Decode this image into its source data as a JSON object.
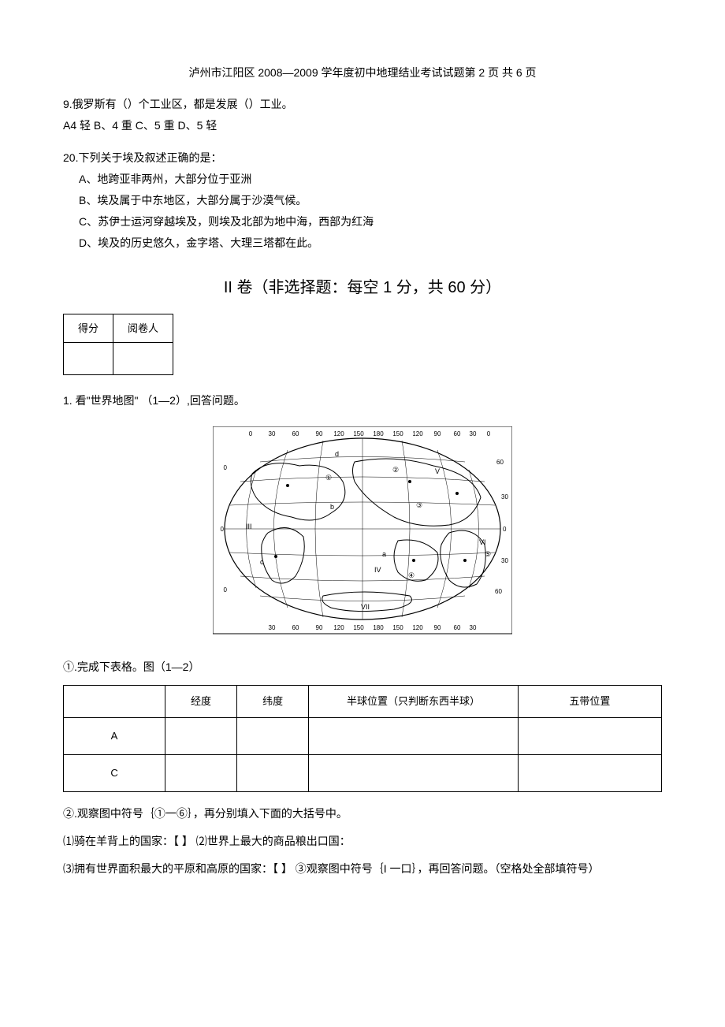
{
  "header": {
    "page_info": "泸州市江阳区 2008—2009 学年度初中地理结业考试试题第 2 页  共 6 页"
  },
  "q9": {
    "stem": "9.俄罗斯有（）个工业区，都是发展（）工业。",
    "options": "A4 轻 B、4 重 C、5 重 D、5 轻"
  },
  "q20": {
    "stem": "20.下列关于埃及叙述正确的是：",
    "opt_a": "A、地跨亚非两州，大部分位于亚洲",
    "opt_b": "B、埃及属于中东地区，大部分属于沙漠气候。",
    "opt_c": "C、苏伊士运河穿越埃及，则埃及北部为地中海，西部为红海",
    "opt_d": "D、埃及的历史悠久，金字塔、大理三塔都在此。"
  },
  "section2": {
    "title": "II 卷（非选择题：每空 1 分，共 60 分）"
  },
  "score_table": {
    "h1": "得分",
    "h2": "阅卷人"
  },
  "q2_1": {
    "stem": "1. 看\"世界地图\"  （1—2）,回答问题。",
    "sub1": "①.完成下表格。图（1—2）",
    "table": {
      "c0": "",
      "c1": "经度",
      "c2": "纬度",
      "c3": "半球位置（只判断东西半球）",
      "c4": "五带位置",
      "r1": "A",
      "r2": "C"
    },
    "sub2": "②.观察图中符号｛①一⑥｝，再分别填入下面的大括号中。",
    "line1": "⑴骑在羊背上的国家：【 】 ⑵世界上最大的商品粮出口国：",
    "line2": "⑶拥有世界面积最大的平原和高原的国家：【 】 ③观察图中符号｛I 一口｝，再回答问题。（空格处全部填符号）"
  }
}
